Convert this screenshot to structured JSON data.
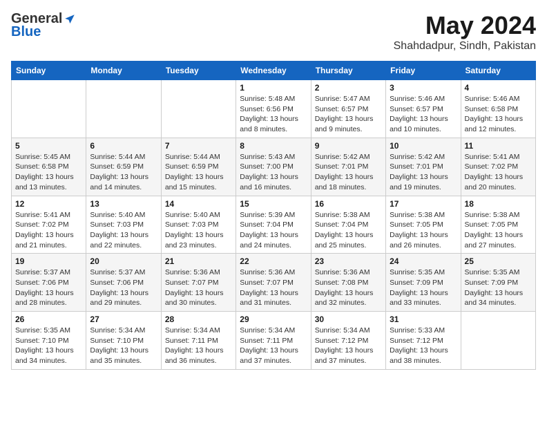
{
  "logo": {
    "general": "General",
    "blue": "Blue"
  },
  "title": "May 2024",
  "subtitle": "Shahdadpur, Sindh, Pakistan",
  "days_of_week": [
    "Sunday",
    "Monday",
    "Tuesday",
    "Wednesday",
    "Thursday",
    "Friday",
    "Saturday"
  ],
  "weeks": [
    [
      {
        "day": "",
        "info": ""
      },
      {
        "day": "",
        "info": ""
      },
      {
        "day": "",
        "info": ""
      },
      {
        "day": "1",
        "info": "Sunrise: 5:48 AM\nSunset: 6:56 PM\nDaylight: 13 hours and 8 minutes."
      },
      {
        "day": "2",
        "info": "Sunrise: 5:47 AM\nSunset: 6:57 PM\nDaylight: 13 hours and 9 minutes."
      },
      {
        "day": "3",
        "info": "Sunrise: 5:46 AM\nSunset: 6:57 PM\nDaylight: 13 hours and 10 minutes."
      },
      {
        "day": "4",
        "info": "Sunrise: 5:46 AM\nSunset: 6:58 PM\nDaylight: 13 hours and 12 minutes."
      }
    ],
    [
      {
        "day": "5",
        "info": "Sunrise: 5:45 AM\nSunset: 6:58 PM\nDaylight: 13 hours and 13 minutes."
      },
      {
        "day": "6",
        "info": "Sunrise: 5:44 AM\nSunset: 6:59 PM\nDaylight: 13 hours and 14 minutes."
      },
      {
        "day": "7",
        "info": "Sunrise: 5:44 AM\nSunset: 6:59 PM\nDaylight: 13 hours and 15 minutes."
      },
      {
        "day": "8",
        "info": "Sunrise: 5:43 AM\nSunset: 7:00 PM\nDaylight: 13 hours and 16 minutes."
      },
      {
        "day": "9",
        "info": "Sunrise: 5:42 AM\nSunset: 7:01 PM\nDaylight: 13 hours and 18 minutes."
      },
      {
        "day": "10",
        "info": "Sunrise: 5:42 AM\nSunset: 7:01 PM\nDaylight: 13 hours and 19 minutes."
      },
      {
        "day": "11",
        "info": "Sunrise: 5:41 AM\nSunset: 7:02 PM\nDaylight: 13 hours and 20 minutes."
      }
    ],
    [
      {
        "day": "12",
        "info": "Sunrise: 5:41 AM\nSunset: 7:02 PM\nDaylight: 13 hours and 21 minutes."
      },
      {
        "day": "13",
        "info": "Sunrise: 5:40 AM\nSunset: 7:03 PM\nDaylight: 13 hours and 22 minutes."
      },
      {
        "day": "14",
        "info": "Sunrise: 5:40 AM\nSunset: 7:03 PM\nDaylight: 13 hours and 23 minutes."
      },
      {
        "day": "15",
        "info": "Sunrise: 5:39 AM\nSunset: 7:04 PM\nDaylight: 13 hours and 24 minutes."
      },
      {
        "day": "16",
        "info": "Sunrise: 5:38 AM\nSunset: 7:04 PM\nDaylight: 13 hours and 25 minutes."
      },
      {
        "day": "17",
        "info": "Sunrise: 5:38 AM\nSunset: 7:05 PM\nDaylight: 13 hours and 26 minutes."
      },
      {
        "day": "18",
        "info": "Sunrise: 5:38 AM\nSunset: 7:05 PM\nDaylight: 13 hours and 27 minutes."
      }
    ],
    [
      {
        "day": "19",
        "info": "Sunrise: 5:37 AM\nSunset: 7:06 PM\nDaylight: 13 hours and 28 minutes."
      },
      {
        "day": "20",
        "info": "Sunrise: 5:37 AM\nSunset: 7:06 PM\nDaylight: 13 hours and 29 minutes."
      },
      {
        "day": "21",
        "info": "Sunrise: 5:36 AM\nSunset: 7:07 PM\nDaylight: 13 hours and 30 minutes."
      },
      {
        "day": "22",
        "info": "Sunrise: 5:36 AM\nSunset: 7:07 PM\nDaylight: 13 hours and 31 minutes."
      },
      {
        "day": "23",
        "info": "Sunrise: 5:36 AM\nSunset: 7:08 PM\nDaylight: 13 hours and 32 minutes."
      },
      {
        "day": "24",
        "info": "Sunrise: 5:35 AM\nSunset: 7:09 PM\nDaylight: 13 hours and 33 minutes."
      },
      {
        "day": "25",
        "info": "Sunrise: 5:35 AM\nSunset: 7:09 PM\nDaylight: 13 hours and 34 minutes."
      }
    ],
    [
      {
        "day": "26",
        "info": "Sunrise: 5:35 AM\nSunset: 7:10 PM\nDaylight: 13 hours and 34 minutes."
      },
      {
        "day": "27",
        "info": "Sunrise: 5:34 AM\nSunset: 7:10 PM\nDaylight: 13 hours and 35 minutes."
      },
      {
        "day": "28",
        "info": "Sunrise: 5:34 AM\nSunset: 7:11 PM\nDaylight: 13 hours and 36 minutes."
      },
      {
        "day": "29",
        "info": "Sunrise: 5:34 AM\nSunset: 7:11 PM\nDaylight: 13 hours and 37 minutes."
      },
      {
        "day": "30",
        "info": "Sunrise: 5:34 AM\nSunset: 7:12 PM\nDaylight: 13 hours and 37 minutes."
      },
      {
        "day": "31",
        "info": "Sunrise: 5:33 AM\nSunset: 7:12 PM\nDaylight: 13 hours and 38 minutes."
      },
      {
        "day": "",
        "info": ""
      }
    ]
  ]
}
